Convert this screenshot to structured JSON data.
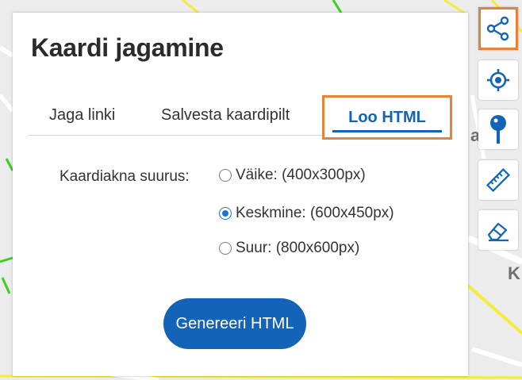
{
  "dialog": {
    "title": "Kaardi jagamine",
    "tabs": [
      {
        "label": "Jaga linki",
        "active": false
      },
      {
        "label": "Salvesta kaardipilt",
        "active": false
      },
      {
        "label": "Loo HTML",
        "active": true
      }
    ],
    "size_label": "Kaardiakna suurus:",
    "size_options": [
      {
        "label": "Väike: (400x300px)",
        "checked": false
      },
      {
        "label": "Keskmine: (600x450px)",
        "checked": true
      },
      {
        "label": "Suur: (800x600px)",
        "checked": false
      }
    ],
    "generate_button": "Genereeri HTML"
  },
  "toolbar": {
    "items": [
      {
        "icon": "share-icon",
        "highlighted": true
      },
      {
        "icon": "locate-icon"
      },
      {
        "icon": "pin-icon"
      },
      {
        "icon": "ruler-icon"
      },
      {
        "icon": "eraser-icon"
      }
    ]
  },
  "map": {
    "labels": [
      "a",
      "K"
    ]
  },
  "colors": {
    "accent": "#1363b8",
    "highlight": "#e6833a",
    "road_yellow": "#f5ec3a",
    "road_green": "#39d020"
  }
}
